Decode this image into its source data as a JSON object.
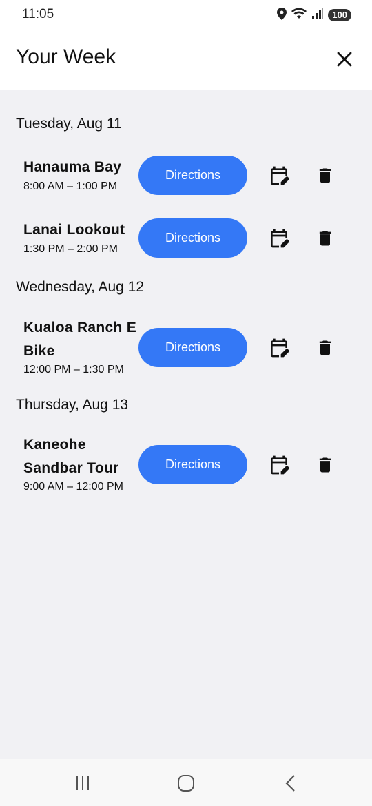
{
  "status_bar": {
    "time": "11:05",
    "battery": "100"
  },
  "header": {
    "title": "Your Week"
  },
  "days": [
    {
      "label": "Tuesday, Aug 11",
      "items": [
        {
          "name": "Hanauma Bay",
          "time": "8:00 AM – 1:00 PM",
          "directions_label": "Directions"
        },
        {
          "name": "Lanai Lookout",
          "time": "1:30 PM – 2:00 PM",
          "directions_label": "Directions"
        }
      ]
    },
    {
      "label": "Wednesday, Aug 12",
      "items": [
        {
          "name": "Kualoa Ranch E Bike",
          "time": "12:00 PM – 1:30 PM",
          "directions_label": "Directions"
        }
      ]
    },
    {
      "label": "Thursday, Aug 13",
      "items": [
        {
          "name": "Kaneohe Sandbar Tour",
          "time": "9:00 AM – 12:00 PM",
          "directions_label": "Directions"
        }
      ]
    }
  ],
  "colors": {
    "accent": "#3478f6",
    "background": "#f1f1f4",
    "header": "#ffffff"
  }
}
